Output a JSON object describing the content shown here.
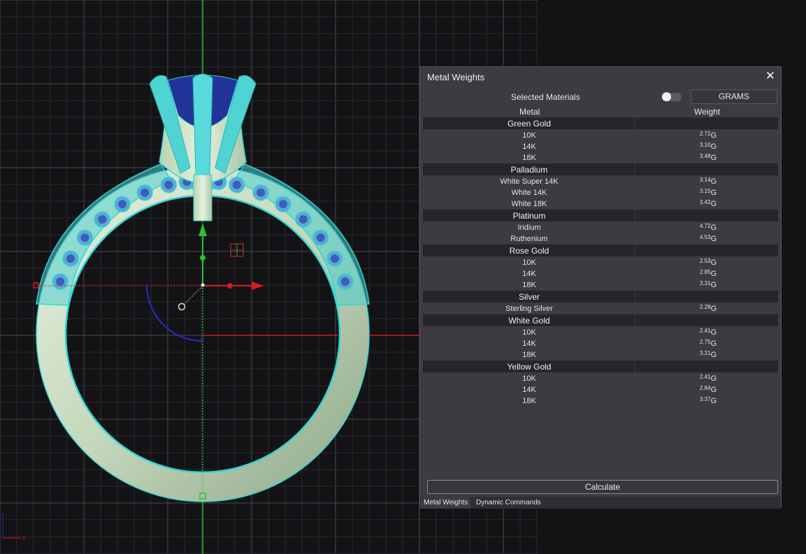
{
  "panel": {
    "title": "Metal Weights",
    "close_icon": "close-icon",
    "selected_materials_label": "Selected Materials",
    "selected_materials_toggle": false,
    "unit_button": "GRAMS",
    "col_metal": "Metal",
    "col_weight": "Weight",
    "unit_suffix": "G",
    "calculate_label": "Calculate",
    "tabs": [
      "Metal Weights",
      "Dynamic Commands"
    ]
  },
  "groups": [
    {
      "name": "Green Gold",
      "items": [
        {
          "metal": "10K",
          "weight": "2.72"
        },
        {
          "metal": "14K",
          "weight": "3.10"
        },
        {
          "metal": "18K",
          "weight": "3.48"
        }
      ]
    },
    {
      "name": "Palladium",
      "items": [
        {
          "metal": "White Super 14K",
          "weight": "3.14"
        },
        {
          "metal": "White 14K",
          "weight": "3.15"
        },
        {
          "metal": "White 18K",
          "weight": "3.42"
        }
      ]
    },
    {
      "name": "Platinum",
      "items": [
        {
          "metal": "Iridium",
          "weight": "4.72"
        },
        {
          "metal": "Ruthenium",
          "weight": "4.53"
        }
      ]
    },
    {
      "name": "Rose Gold",
      "items": [
        {
          "metal": "10K",
          "weight": "2.53"
        },
        {
          "metal": "14K",
          "weight": "2.85"
        },
        {
          "metal": "18K",
          "weight": "3.31"
        }
      ]
    },
    {
      "name": "Silver",
      "items": [
        {
          "metal": "Sterling Silver",
          "weight": "2.28"
        }
      ]
    },
    {
      "name": "White Gold",
      "items": [
        {
          "metal": "10K",
          "weight": "2.41"
        },
        {
          "metal": "14K",
          "weight": "2.75"
        },
        {
          "metal": "18K",
          "weight": "3.21"
        }
      ]
    },
    {
      "name": "Yellow Gold",
      "items": [
        {
          "metal": "10K",
          "weight": "2.41"
        },
        {
          "metal": "14K",
          "weight": "2.84"
        },
        {
          "metal": "18K",
          "weight": "3.37"
        }
      ]
    }
  ],
  "viewport": {
    "axis_x_label": "x",
    "colors": {
      "ring_metal": "#c9dcc0",
      "selection": "#2fd6d6",
      "gem": "#22349a",
      "axis_x": "#e02020",
      "axis_y": "#20c020"
    }
  }
}
